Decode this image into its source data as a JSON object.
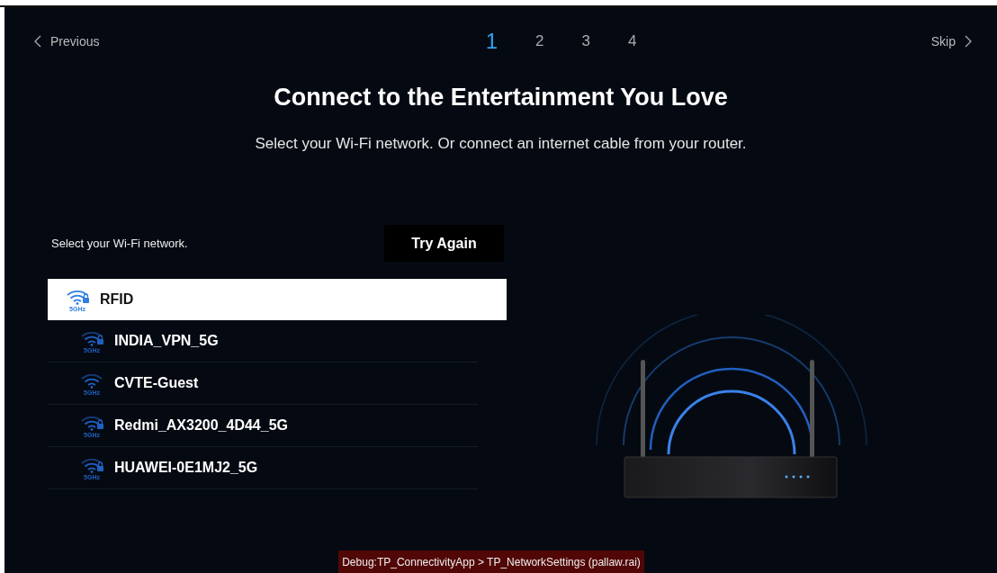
{
  "nav": {
    "previous": "Previous",
    "skip": "Skip"
  },
  "steps": [
    {
      "label": "1",
      "selected": true
    },
    {
      "label": "2",
      "selected": false
    },
    {
      "label": "3",
      "selected": false
    },
    {
      "label": "4",
      "selected": false
    }
  ],
  "title": "Connect to the Entertainment You Love",
  "subtitle": "Select your Wi-Fi network. Or connect an internet cable from your router.",
  "list_label": "Select your Wi-Fi network.",
  "try_again": "Try Again",
  "networks": [
    {
      "name": "RFID",
      "band": "5GHz",
      "locked": true,
      "selected": true
    },
    {
      "name": "INDIA_VPN_5G",
      "band": "5GHz",
      "locked": true,
      "selected": false
    },
    {
      "name": "CVTE-Guest",
      "band": "5GHz",
      "locked": false,
      "selected": false
    },
    {
      "name": "Redmi_AX3200_4D44_5G",
      "band": "5GHz",
      "locked": true,
      "selected": false
    },
    {
      "name": "HUAWEI-0E1MJ2_5G",
      "band": "5GHz",
      "locked": true,
      "selected": false
    }
  ],
  "debug": "Debug:TP_ConnectivityApp > TP_NetworkSettings (pallaw.rai)"
}
